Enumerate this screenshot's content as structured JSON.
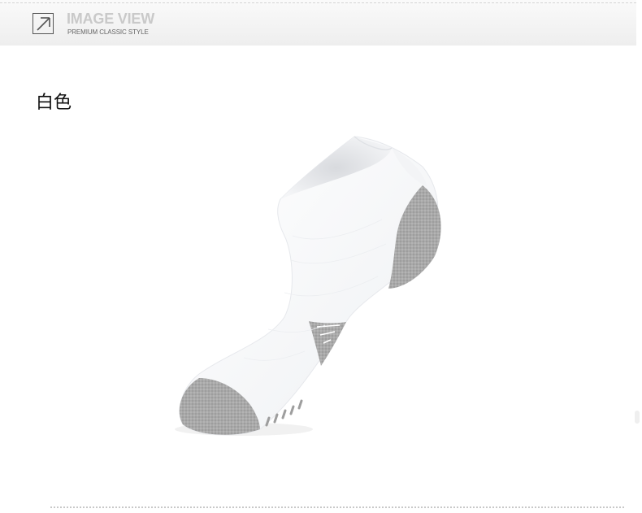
{
  "header": {
    "title": "IMAGE VIEW",
    "subtitle": "PREMIUM CLASSIC STYLE",
    "icon": "arrow-up-right-icon"
  },
  "product": {
    "color_label": "白色",
    "image": "white-ankle-sock-with-gray-heel-and-toe"
  },
  "colors": {
    "sock_body": "#ffffff",
    "sock_accent": "#a8a8a8",
    "header_title": "#c9c9c9"
  }
}
